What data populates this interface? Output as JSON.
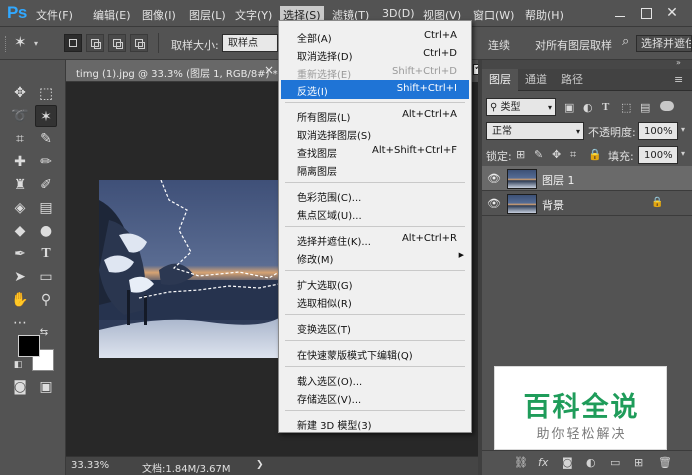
{
  "app": {
    "logo": "Ps"
  },
  "menubar": {
    "items": [
      "文件(F)",
      "编辑(E)",
      "图像(I)",
      "图层(L)",
      "文字(Y)",
      "选择(S)",
      "滤镜(T)",
      "3D(D)",
      "视图(V)",
      "窗口(W)",
      "帮助(H)"
    ],
    "active": "选择(S)"
  },
  "options": {
    "sample_size_label": "取样大小:",
    "sample_size_value": "取样点",
    "contiguous_label": "连续",
    "contiguous_checked": true,
    "sample_all_layers_label": "对所有图层取样",
    "sample_all_layers_checked": false,
    "select_and_mask_label": "选择并遮住..."
  },
  "tools": {
    "icons": [
      "move-icon",
      "marquee-icon",
      "lasso-icon",
      "magic-wand-icon",
      "crop-icon",
      "eyedropper-icon",
      "healing-brush-icon",
      "brush-icon",
      "clone-stamp-icon",
      "history-brush-icon",
      "eraser-icon",
      "gradient-icon",
      "blur-icon",
      "dodge-icon",
      "pen-icon",
      "type-icon",
      "path-selection-icon",
      "rectangle-icon",
      "hand-icon",
      "zoom-icon",
      "more-tools-icon",
      "quick-mask-icon",
      "screen-mode-icon"
    ],
    "active": "magic-wand-icon"
  },
  "document": {
    "tab_title": "timg (1).jpg @ 33.3% (图层 1, RGB/8#) *",
    "zoom": "33.33%",
    "doc_size": "文档:1.84M/3.67M"
  },
  "dropdown": {
    "groups": [
      [
        {
          "label": "全部(A)",
          "shortcut": "Ctrl+A"
        },
        {
          "label": "取消选择(D)",
          "shortcut": "Ctrl+D"
        },
        {
          "label": "重新选择(E)",
          "shortcut": "Shift+Ctrl+D",
          "disabled": true
        },
        {
          "label": "反选(I)",
          "shortcut": "Shift+Ctrl+I",
          "highlighted": true
        }
      ],
      [
        {
          "label": "所有图层(L)",
          "shortcut": "Alt+Ctrl+A"
        },
        {
          "label": "取消选择图层(S)",
          "shortcut": ""
        },
        {
          "label": "查找图层",
          "shortcut": "Alt+Shift+Ctrl+F"
        },
        {
          "label": "隔离图层",
          "shortcut": ""
        }
      ],
      [
        {
          "label": "色彩范围(C)...",
          "shortcut": ""
        },
        {
          "label": "焦点区域(U)...",
          "shortcut": ""
        }
      ],
      [
        {
          "label": "选择并遮住(K)...",
          "shortcut": "Alt+Ctrl+R"
        },
        {
          "label": "修改(M)",
          "shortcut": "",
          "submenu": true
        }
      ],
      [
        {
          "label": "扩大选取(G)",
          "shortcut": ""
        },
        {
          "label": "选取相似(R)",
          "shortcut": ""
        }
      ],
      [
        {
          "label": "变换选区(T)",
          "shortcut": ""
        }
      ],
      [
        {
          "label": "在快速蒙版模式下编辑(Q)",
          "shortcut": ""
        }
      ],
      [
        {
          "label": "载入选区(O)...",
          "shortcut": ""
        },
        {
          "label": "存储选区(V)...",
          "shortcut": ""
        }
      ],
      [
        {
          "label": "新建 3D 模型(3)",
          "shortcut": ""
        }
      ]
    ]
  },
  "layers_panel": {
    "tabs": [
      "图层",
      "通道",
      "路径"
    ],
    "active_tab": "图层",
    "filter_kind": "类型",
    "blend_mode": "正常",
    "opacity_label": "不透明度:",
    "opacity_value": "100%",
    "lock_label": "锁定:",
    "fill_label": "填充:",
    "fill_value": "100%",
    "layers": [
      {
        "name": "图层 1",
        "selected": true,
        "locked": false
      },
      {
        "name": "背景",
        "selected": false,
        "locked": true
      }
    ]
  },
  "watermark": {
    "title": "百科全说",
    "subtitle": "助你轻松解决",
    "color": "#1f9c5a"
  },
  "colors": {
    "highlight": "#1f74d6",
    "ui_bg": "#535353",
    "canvas_bg": "#282828"
  }
}
